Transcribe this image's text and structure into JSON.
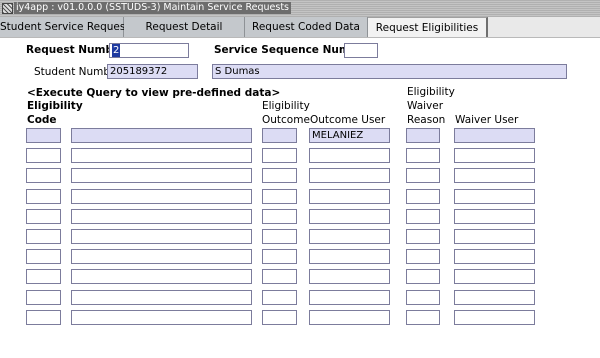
{
  "window": {
    "title": "iy4app : v01.0.0.0 (SSTUDS-3) Maintain Service Requests"
  },
  "tabs": [
    {
      "label": "Student Service Request",
      "active": false
    },
    {
      "label": "Request Detail",
      "active": false
    },
    {
      "label": "Request Coded Data",
      "active": false
    },
    {
      "label": "Request Eligibilities",
      "active": true
    }
  ],
  "header": {
    "request_number_label": "Request Number",
    "request_number_value": "2",
    "service_sequence_label": "Service Sequence Number",
    "service_sequence_value": "",
    "student_number_label": "Student Number",
    "student_number_value": "205189372",
    "student_name_value": "S Dumas"
  },
  "grid": {
    "hint": "<Execute Query to view pre-defined data>",
    "columns": {
      "eligibility_code_line1": "Eligibility",
      "eligibility_code_line2": "Code",
      "eligibility_outcome_line1": "Eligibility",
      "eligibility_outcome_line2": "Outcome",
      "outcome_user": "Outcome User",
      "waiver_reason_line1": "Eligibility",
      "waiver_reason_line2": "Waiver",
      "waiver_reason_line3": "Reason",
      "waiver_user": "Waiver User"
    },
    "rows": [
      {
        "code": "",
        "description": "",
        "outcome": "",
        "outcome_user": "MELANIEZ",
        "waiver_reason": "",
        "waiver_user": ""
      },
      {
        "code": "",
        "description": "",
        "outcome": "",
        "outcome_user": "",
        "waiver_reason": "",
        "waiver_user": ""
      },
      {
        "code": "",
        "description": "",
        "outcome": "",
        "outcome_user": "",
        "waiver_reason": "",
        "waiver_user": ""
      },
      {
        "code": "",
        "description": "",
        "outcome": "",
        "outcome_user": "",
        "waiver_reason": "",
        "waiver_user": ""
      },
      {
        "code": "",
        "description": "",
        "outcome": "",
        "outcome_user": "",
        "waiver_reason": "",
        "waiver_user": ""
      },
      {
        "code": "",
        "description": "",
        "outcome": "",
        "outcome_user": "",
        "waiver_reason": "",
        "waiver_user": ""
      },
      {
        "code": "",
        "description": "",
        "outcome": "",
        "outcome_user": "",
        "waiver_reason": "",
        "waiver_user": ""
      },
      {
        "code": "",
        "description": "",
        "outcome": "",
        "outcome_user": "",
        "waiver_reason": "",
        "waiver_user": ""
      },
      {
        "code": "",
        "description": "",
        "outcome": "",
        "outcome_user": "",
        "waiver_reason": "",
        "waiver_user": ""
      },
      {
        "code": "",
        "description": "",
        "outcome": "",
        "outcome_user": "",
        "waiver_reason": "",
        "waiver_user": ""
      }
    ]
  },
  "colors": {
    "query_field_bg": "#dcdcf4",
    "cursor_bg": "#1e3aa0"
  }
}
